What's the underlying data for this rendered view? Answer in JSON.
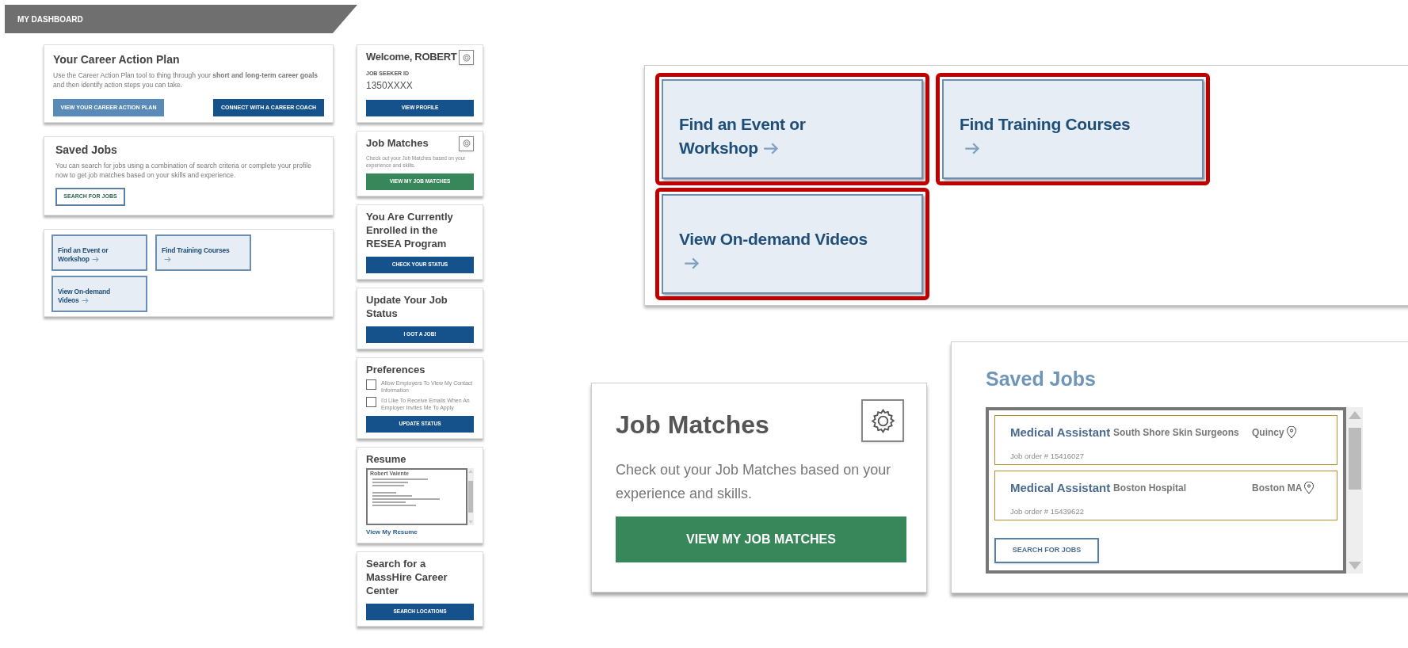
{
  "header": {
    "title": "MY DASHBOARD"
  },
  "career_plan": {
    "title": "Your Career Action Plan",
    "description": "Use the Career Action Plan tool to thing through your **short and long-term career goals** and then identify action steps you can take.",
    "buttons": [
      {
        "label": "VIEW YOUR CAREER ACTION PLAN",
        "kind": "light"
      },
      {
        "label": "CONNECT WITH A CAREER COACH",
        "kind": "dark"
      }
    ]
  },
  "saved_jobs": {
    "title": "Saved Jobs",
    "description": "You can search for jobs using a combination of search criteria or complete your profile now to get job matches based on your skills and experience.",
    "button": "SEARCH FOR JOBS"
  },
  "tiles": [
    {
      "label": "Find an Event or Workshop"
    },
    {
      "label": "Find Training Courses"
    },
    {
      "label": "View On-demand Videos"
    }
  ],
  "sidebar": [
    {
      "kind": "welcome",
      "title": "Welcome, ROBERT",
      "id_label": "JOB SEEKER ID",
      "id_value": "1350XXXX",
      "button": "VIEW PROFILE"
    },
    {
      "kind": "matches",
      "title": "Job Matches",
      "description": "Check out your Job Matches based on your experience and skills.",
      "button": "VIEW MY JOB MATCHES"
    },
    {
      "kind": "action",
      "title": "You Are Currently Enrolled in the RESEA Program",
      "button": "CHECK YOUR STATUS"
    },
    {
      "kind": "action",
      "title": "Update Your Job Status",
      "button": "I GOT A JOB!"
    },
    {
      "kind": "preferences",
      "title": "Preferences",
      "options": [
        {
          "label": "Allow Employers To View My Contact Information",
          "checked": false
        },
        {
          "label": "I'd Like To Receive Emails When An Employer Invites Me To Apply",
          "checked": false
        }
      ],
      "button": "UPDATE STATUS"
    },
    {
      "kind": "resume",
      "title": "Resume",
      "name": "Robert Valente",
      "link": "View My Resume"
    },
    {
      "kind": "action",
      "title": "Search for a MassHire Career Center",
      "button": "SEARCH LOCATIONS"
    }
  ],
  "callout_tiles": [
    {
      "label": "Find an Event or Workshop"
    },
    {
      "label": "Find Training Courses"
    },
    {
      "label": "View On-demand Videos"
    }
  ],
  "callout_matches": {
    "title": "Job Matches",
    "description": "Check out your Job Matches based on your experience and skills.",
    "button": "VIEW MY JOB MATCHES"
  },
  "callout_saved": {
    "title": "Saved Jobs",
    "jobs": [
      {
        "title": "Medical Assistant",
        "company": "South Shore Skin Surgeons",
        "location": "Quincy",
        "order": "Job order # 15416027"
      },
      {
        "title": "Medical Assistant",
        "company": "Boston Hospital",
        "location": "Boston MA",
        "order": "Job order # 15439622"
      }
    ],
    "button": "SEARCH FOR JOBS"
  }
}
